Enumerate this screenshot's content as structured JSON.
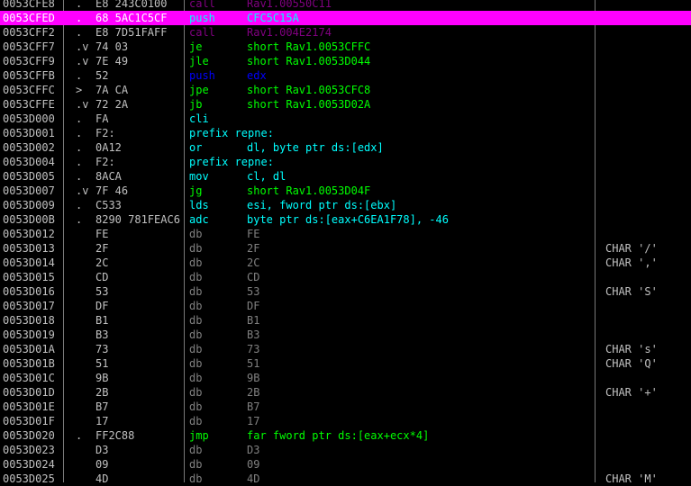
{
  "colors": {
    "background": "#000000",
    "text": "#c0c0c0",
    "call": "#800080",
    "jump": "#00ff00",
    "push": "#0000ff",
    "normal": "#00ffff",
    "db": "#808080",
    "selection": "#ff00ff"
  },
  "rows": [
    {
      "addr": "0053CFE8",
      "mark": ".",
      "hex": "E8 243C0100",
      "mn": "call",
      "op": "Rav1.00550C11",
      "cm": "",
      "kind": "call",
      "partial": "top"
    },
    {
      "addr": "0053CFED",
      "mark": ".",
      "hex": "68 5AC1C5CF",
      "mn": "push",
      "op": "CFC5C15A",
      "cm": "",
      "kind": "push",
      "selected": true
    },
    {
      "addr": "0053CFF2",
      "mark": ".",
      "hex": "E8 7D51FAFF",
      "mn": "call",
      "op": "Rav1.004E2174",
      "cm": "",
      "kind": "call"
    },
    {
      "addr": "0053CFF7",
      "mark": ".v",
      "hex": "74 03",
      "mn": "je",
      "op": "short Rav1.0053CFFC",
      "cm": "",
      "kind": "jump"
    },
    {
      "addr": "0053CFF9",
      "mark": ".v",
      "hex": "7E 49",
      "mn": "jle",
      "op": "short Rav1.0053D044",
      "cm": "",
      "kind": "jump"
    },
    {
      "addr": "0053CFFB",
      "mark": ".",
      "hex": "52",
      "mn": "push",
      "op": "edx",
      "cm": "",
      "kind": "push"
    },
    {
      "addr": "0053CFFC",
      "mark": ">",
      "hex": "7A CA",
      "mn": "jpe",
      "op": "short Rav1.0053CFC8",
      "cm": "",
      "kind": "jump"
    },
    {
      "addr": "0053CFFE",
      "mark": ".v",
      "hex": "72 2A",
      "mn": "jb",
      "op": "short Rav1.0053D02A",
      "cm": "",
      "kind": "jump"
    },
    {
      "addr": "0053D000",
      "mark": ".",
      "hex": "FA",
      "mn": "cli",
      "op": "",
      "cm": "",
      "kind": "normal"
    },
    {
      "addr": "0053D001",
      "mark": ".",
      "hex": "F2:",
      "mn": "prefix repne:",
      "op": "",
      "cm": "",
      "kind": "normal"
    },
    {
      "addr": "0053D002",
      "mark": ".",
      "hex": "0A12",
      "mn": "or",
      "op": "dl, byte ptr ds:[edx]",
      "cm": "",
      "kind": "normal"
    },
    {
      "addr": "0053D004",
      "mark": ".",
      "hex": "F2:",
      "mn": "prefix repne:",
      "op": "",
      "cm": "",
      "kind": "normal"
    },
    {
      "addr": "0053D005",
      "mark": ".",
      "hex": "8ACA",
      "mn": "mov",
      "op": "cl, dl",
      "cm": "",
      "kind": "normal"
    },
    {
      "addr": "0053D007",
      "mark": ".v",
      "hex": "7F 46",
      "mn": "jg",
      "op": "short Rav1.0053D04F",
      "cm": "",
      "kind": "jump"
    },
    {
      "addr": "0053D009",
      "mark": ".",
      "hex": "C533",
      "mn": "lds",
      "op": "esi, fword ptr ds:[ebx]",
      "cm": "",
      "kind": "normal"
    },
    {
      "addr": "0053D00B",
      "mark": ".",
      "hex": "8290 781FEAC6",
      "mn": "adc",
      "op": "byte ptr ds:[eax+C6EA1F78], -46",
      "cm": "",
      "kind": "normal"
    },
    {
      "addr": "0053D012",
      "mark": "",
      "hex": "FE",
      "mn": "db",
      "op": "FE",
      "cm": "",
      "kind": "db"
    },
    {
      "addr": "0053D013",
      "mark": "",
      "hex": "2F",
      "mn": "db",
      "op": "2F",
      "cm": "CHAR '/'",
      "kind": "db"
    },
    {
      "addr": "0053D014",
      "mark": "",
      "hex": "2C",
      "mn": "db",
      "op": "2C",
      "cm": "CHAR ','",
      "kind": "db"
    },
    {
      "addr": "0053D015",
      "mark": "",
      "hex": "CD",
      "mn": "db",
      "op": "CD",
      "cm": "",
      "kind": "db"
    },
    {
      "addr": "0053D016",
      "mark": "",
      "hex": "53",
      "mn": "db",
      "op": "53",
      "cm": "CHAR 'S'",
      "kind": "db"
    },
    {
      "addr": "0053D017",
      "mark": "",
      "hex": "DF",
      "mn": "db",
      "op": "DF",
      "cm": "",
      "kind": "db"
    },
    {
      "addr": "0053D018",
      "mark": "",
      "hex": "B1",
      "mn": "db",
      "op": "B1",
      "cm": "",
      "kind": "db"
    },
    {
      "addr": "0053D019",
      "mark": "",
      "hex": "B3",
      "mn": "db",
      "op": "B3",
      "cm": "",
      "kind": "db"
    },
    {
      "addr": "0053D01A",
      "mark": "",
      "hex": "73",
      "mn": "db",
      "op": "73",
      "cm": "CHAR 's'",
      "kind": "db"
    },
    {
      "addr": "0053D01B",
      "mark": "",
      "hex": "51",
      "mn": "db",
      "op": "51",
      "cm": "CHAR 'Q'",
      "kind": "db"
    },
    {
      "addr": "0053D01C",
      "mark": "",
      "hex": "9B",
      "mn": "db",
      "op": "9B",
      "cm": "",
      "kind": "db"
    },
    {
      "addr": "0053D01D",
      "mark": "",
      "hex": "2B",
      "mn": "db",
      "op": "2B",
      "cm": "CHAR '+'",
      "kind": "db"
    },
    {
      "addr": "0053D01E",
      "mark": "",
      "hex": "B7",
      "mn": "db",
      "op": "B7",
      "cm": "",
      "kind": "db"
    },
    {
      "addr": "0053D01F",
      "mark": "",
      "hex": "17",
      "mn": "db",
      "op": "17",
      "cm": "",
      "kind": "db"
    },
    {
      "addr": "0053D020",
      "mark": ".",
      "hex": "FF2C88",
      "mn": "jmp",
      "op": "far fword ptr ds:[eax+ecx*4]",
      "cm": "",
      "kind": "jump"
    },
    {
      "addr": "0053D023",
      "mark": "",
      "hex": "D3",
      "mn": "db",
      "op": "D3",
      "cm": "",
      "kind": "db"
    },
    {
      "addr": "0053D024",
      "mark": "",
      "hex": "09",
      "mn": "db",
      "op": "09",
      "cm": "",
      "kind": "db"
    },
    {
      "addr": "0053D025",
      "mark": "",
      "hex": "4D",
      "mn": "db",
      "op": "4D",
      "cm": "CHAR 'M'",
      "kind": "db",
      "partial": "bottom"
    }
  ]
}
